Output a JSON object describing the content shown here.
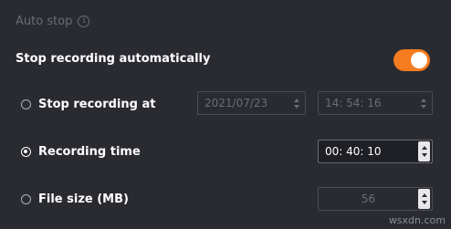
{
  "section": {
    "title": "Auto stop",
    "info_icon": "i"
  },
  "main_toggle": {
    "label": "Stop recording automatically",
    "state": "on",
    "accent_color": "#f57c1f"
  },
  "options": {
    "stop_at": {
      "label": "Stop recording at",
      "selected": false,
      "date": "2021/07/23",
      "time": "14: 54: 16"
    },
    "recording_time": {
      "label": "Recording time",
      "selected": true,
      "value": "00: 40: 10"
    },
    "file_size": {
      "label": "File size (MB)",
      "selected": false,
      "value": "56"
    }
  },
  "watermark": "wsxdn.com"
}
